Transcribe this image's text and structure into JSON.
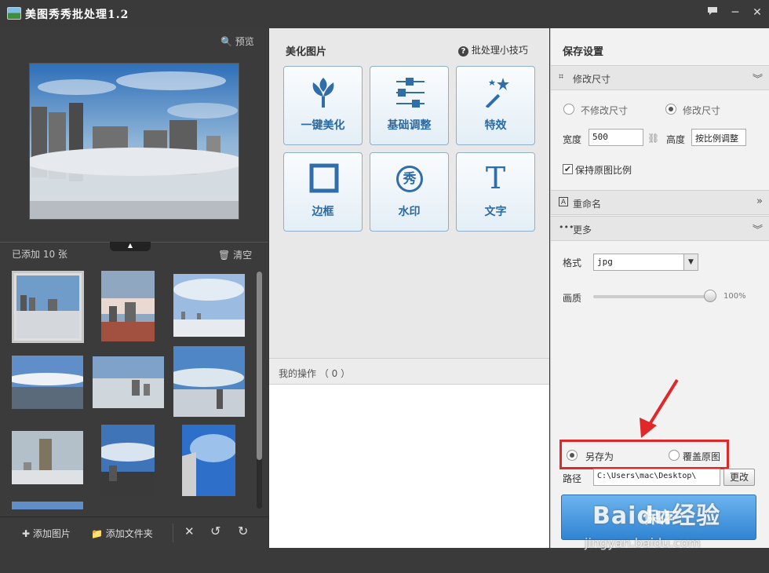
{
  "window": {
    "title": "美图秀秀批处理1.2",
    "feedback_icon": "chat-icon",
    "minimize": "─",
    "close": "✕"
  },
  "left": {
    "preview_label": "预览",
    "added_count": "已添加 10 张",
    "clear_label": "清空",
    "collapse_glyph": "▲",
    "bottom": {
      "add_image": "添加图片",
      "add_folder": "添加文件夹",
      "delete_glyph": "✕",
      "rotate_left_glyph": "↺",
      "rotate_right_glyph": "↻"
    }
  },
  "middle": {
    "beautify_title": "美化图片",
    "tips_link": "批处理小技巧",
    "tools": [
      {
        "label": "一键美化",
        "icon": "tulip-icon"
      },
      {
        "label": "基础调整",
        "icon": "sliders-icon"
      },
      {
        "label": "特效",
        "icon": "magic-wand-icon"
      },
      {
        "label": "边框",
        "icon": "frame-icon"
      },
      {
        "label": "水印",
        "icon": "watermark-icon"
      },
      {
        "label": "文字",
        "icon": "text-icon"
      }
    ],
    "tool_glyphs": {
      "watermark": "秀",
      "text": "T"
    },
    "ops_label": "我的操作 （ 0 ）"
  },
  "right": {
    "title": "保存设置",
    "resize": {
      "header": "修改尺寸",
      "opt_no": "不修改尺寸",
      "opt_yes": "修改尺寸",
      "width_label": "宽度",
      "width_value": "500",
      "height_label": "高度",
      "height_value": "按比例调整",
      "keep_ratio": "保持原图比例",
      "keep_ratio_checked": true
    },
    "rename_header": "重命名",
    "more_header": "更多",
    "format_label": "格式",
    "format_value": "jpg",
    "quality_label": "画质",
    "quality_value": "100%",
    "save_as": "另存为",
    "overwrite": "覆盖原图",
    "path_label": "路径",
    "path_value": "C:\\Users\\mac\\Desktop\\",
    "change_btn": "更改",
    "save_btn": "保存"
  },
  "watermark": {
    "brand": "Baidu经验",
    "url": "jingyan.baidu.com"
  },
  "colors": {
    "accent": "#2f84d2",
    "highlight": "#e0282a",
    "tool_label": "#2a6aa0"
  }
}
